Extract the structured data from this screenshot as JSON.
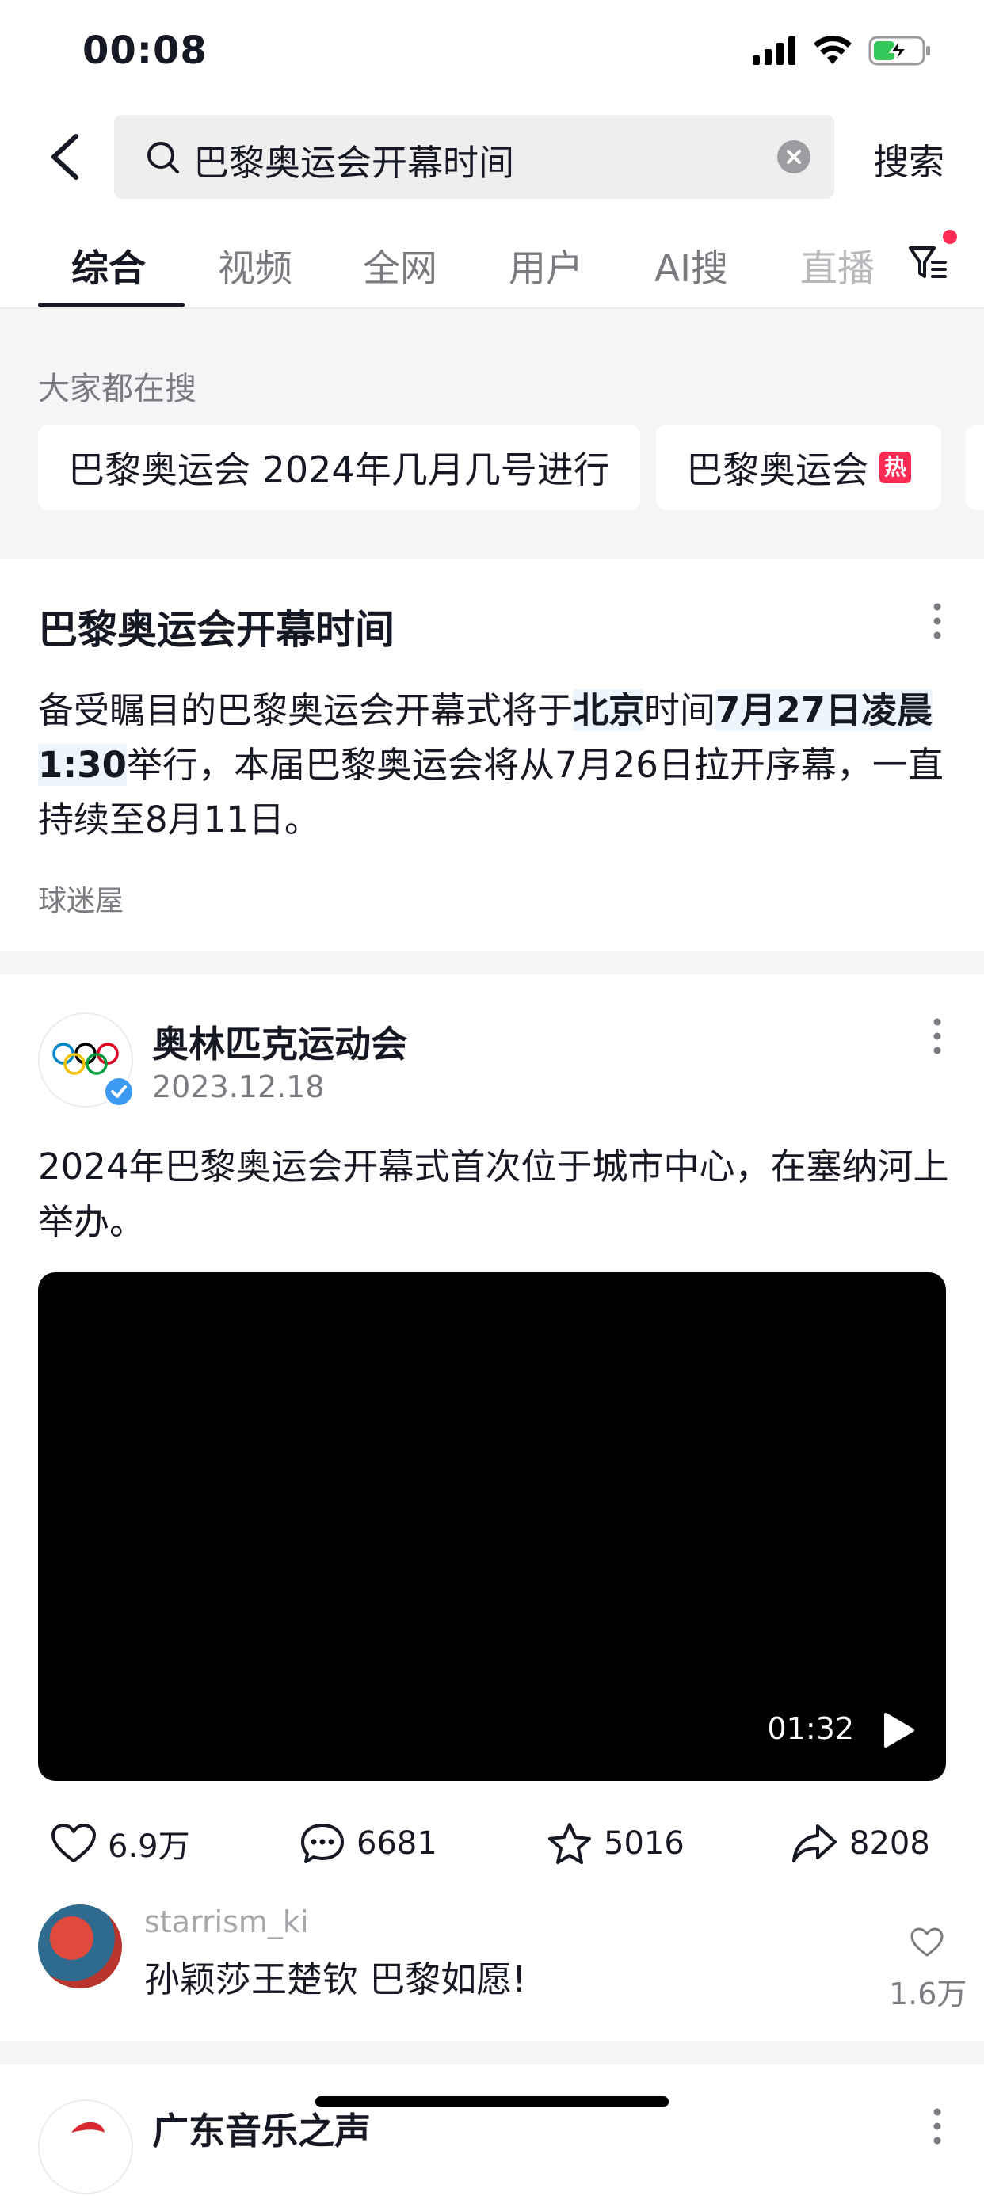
{
  "status_bar": {
    "time": "00:08"
  },
  "search": {
    "query": "巴黎奥运会开幕时间",
    "submit_label": "搜索"
  },
  "tabs": [
    {
      "label": "综合",
      "active": true
    },
    {
      "label": "视频"
    },
    {
      "label": "全网"
    },
    {
      "label": "用户"
    },
    {
      "label": "AI搜"
    },
    {
      "label": "直播"
    }
  ],
  "hot_searches": {
    "title": "大家都在搜",
    "items": [
      {
        "label": "巴黎奥运会 2024年几月几号进行"
      },
      {
        "label": "巴黎奥运会",
        "badge": "热"
      }
    ]
  },
  "answer": {
    "title": "巴黎奥运会开幕时间",
    "text_parts": [
      {
        "text": "备受瞩目的巴黎奥运会开幕式将于",
        "hl": false
      },
      {
        "text": "北京",
        "hl": true
      },
      {
        "text": "时间",
        "hl": false
      },
      {
        "text": "7月27日凌晨1:30",
        "hl": true
      },
      {
        "text": "举行，本届巴黎奥运会将从7月26日拉开序幕，一直持续至8月11日。",
        "hl": false
      }
    ],
    "source": "球迷屋"
  },
  "post": {
    "author": "奥林匹克运动会",
    "date": "2023.12.18",
    "text": "2024年巴黎奥运会开幕式首次位于城市中心，在塞纳河上举办。",
    "video_duration": "01:32",
    "actions": {
      "likes": "6.9万",
      "comments": "6681",
      "favorites": "5016",
      "shares": "8208"
    }
  },
  "comment": {
    "user": "starrism_ki",
    "text": "孙颖莎王楚钦 巴黎如愿!",
    "likes": "1.6万"
  },
  "next_post": {
    "author": "广东音乐之声"
  },
  "colors": {
    "accent": "#fe2c55",
    "verified": "#3d9af2",
    "highlight": "#eef6fd"
  }
}
